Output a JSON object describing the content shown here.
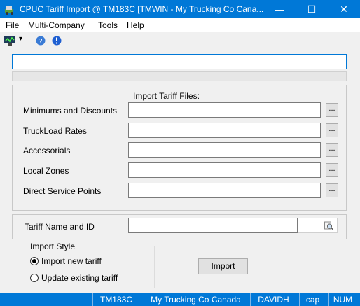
{
  "window": {
    "title": "CPUC Tariff Import @ TM183C [TMWIN - My Trucking Co Cana...",
    "minimize": "—",
    "maximize": "☐",
    "close": "✕"
  },
  "menu": {
    "file": "File",
    "multi_company": "Multi-Company",
    "tools": "Tools",
    "help": "Help"
  },
  "toolbar": {
    "dropdown": "▾"
  },
  "top_input": {
    "value": ""
  },
  "import_files": {
    "heading": "Import Tariff Files:",
    "rows": [
      {
        "label": "Minimums and Discounts",
        "value": "",
        "browse": "..."
      },
      {
        "label": "TruckLoad Rates",
        "value": "",
        "browse": "..."
      },
      {
        "label": "Accessorials",
        "value": "",
        "browse": "..."
      },
      {
        "label": "Local Zones",
        "value": "",
        "browse": "..."
      },
      {
        "label": "Direct Service Points",
        "value": "",
        "browse": "..."
      }
    ]
  },
  "tariff": {
    "label": "Tariff Name and ID",
    "value": ""
  },
  "import_style": {
    "legend": "Import Style",
    "option_new": "Import new tariff",
    "option_update": "Update existing tariff",
    "selected": "new"
  },
  "import_button": "Import",
  "status": {
    "server": "TM183C",
    "company": "My Trucking Co Canada",
    "user": "DAVIDH",
    "caps": "cap",
    "num": "NUM"
  }
}
